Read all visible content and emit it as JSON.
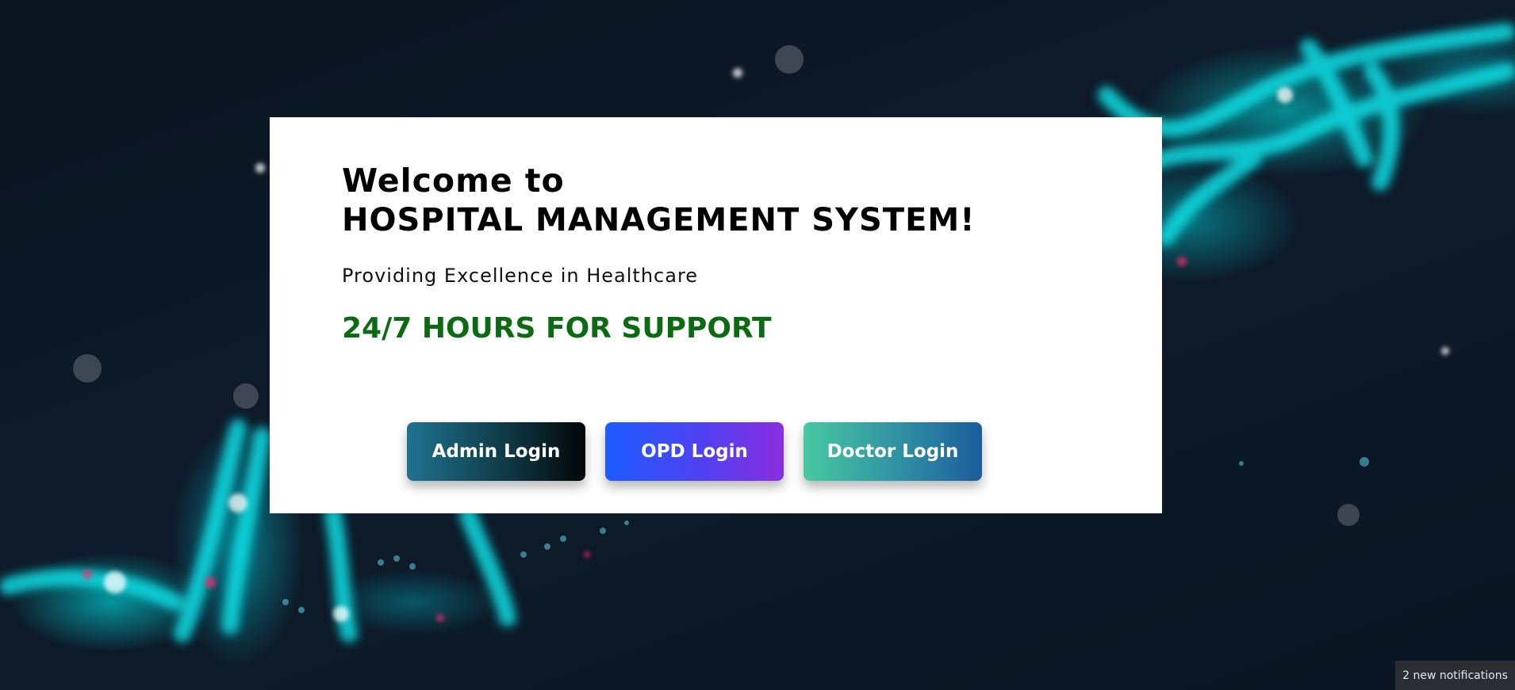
{
  "card": {
    "welcome": "Welcome to",
    "title": "HOSPITAL MANAGEMENT SYSTEM!",
    "tagline": "Providing Excellence in Healthcare",
    "support": "24/7 HOURS FOR SUPPORT"
  },
  "buttons": {
    "admin": "Admin Login",
    "opd": "OPD Login",
    "doctor": "Doctor Login"
  },
  "notifications": {
    "text": "2 new notifications"
  },
  "colors": {
    "support_text": "#0a6b12",
    "card_background": "#ffffff",
    "background": "#0e1b2a",
    "dna_accent": "#00e6e6"
  }
}
